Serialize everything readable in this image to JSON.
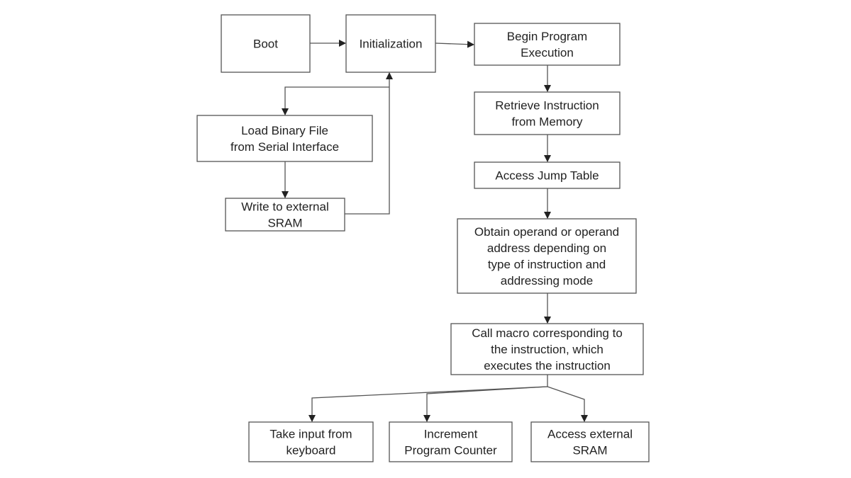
{
  "nodes": {
    "boot": [
      "Boot"
    ],
    "init": [
      "Initialization"
    ],
    "begin": [
      "Begin Program",
      "Execution"
    ],
    "retrieve": [
      "Retrieve Instruction",
      "from Memory"
    ],
    "jump": [
      "Access Jump Table"
    ],
    "operand": [
      "Obtain operand or operand",
      "address depending on",
      "type of instruction and",
      "addressing mode"
    ],
    "macro": [
      "Call macro corresponding to",
      "the instruction, which",
      "executes the instruction"
    ],
    "load": [
      "Load Binary File",
      "from Serial Interface"
    ],
    "write": [
      "Write to external",
      "SRAM"
    ],
    "keyboard": [
      "Take input from",
      "keyboard"
    ],
    "pc": [
      "Increment",
      "Program Counter"
    ],
    "sram": [
      "Access external",
      "SRAM"
    ]
  }
}
